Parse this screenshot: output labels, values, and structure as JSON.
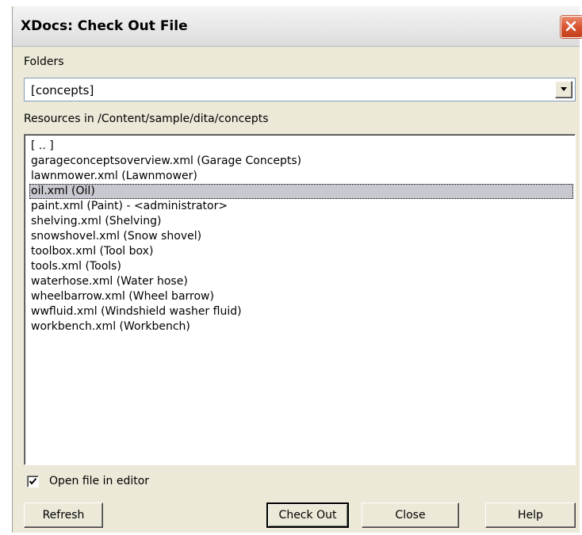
{
  "window": {
    "title": "XDocs: Check Out File"
  },
  "folders": {
    "label": "Folders",
    "selected": "[concepts]"
  },
  "resources": {
    "label": "Resources in  /Content/sample/dita/concepts",
    "items": [
      "[ .. ]",
      "garageconceptsoverview.xml (Garage Concepts)",
      "lawnmower.xml (Lawnmower)",
      "oil.xml (Oil)",
      "paint.xml (Paint) - <administrator>",
      "shelving.xml (Shelving)",
      "snowshovel.xml (Snow shovel)",
      "toolbox.xml (Tool box)",
      "tools.xml (Tools)",
      "waterhose.xml (Water hose)",
      "wheelbarrow.xml (Wheel barrow)",
      "wwfluid.xml (Windshield washer fluid)",
      "workbench.xml (Workbench)"
    ],
    "selected_index": 3
  },
  "options": {
    "open_in_editor_label": "Open file in editor",
    "open_in_editor_checked": true
  },
  "buttons": {
    "refresh": "Refresh",
    "check_out": "Check Out",
    "close": "Close",
    "help": "Help"
  },
  "colors": {
    "dialog_background": "#ece9d8",
    "selection_highlight": "#c8c8d0",
    "close_button": "#d9542f"
  },
  "icons": {
    "close": "close-x-icon",
    "dropdown": "chevron-down-icon",
    "check": "checkmark-icon"
  }
}
